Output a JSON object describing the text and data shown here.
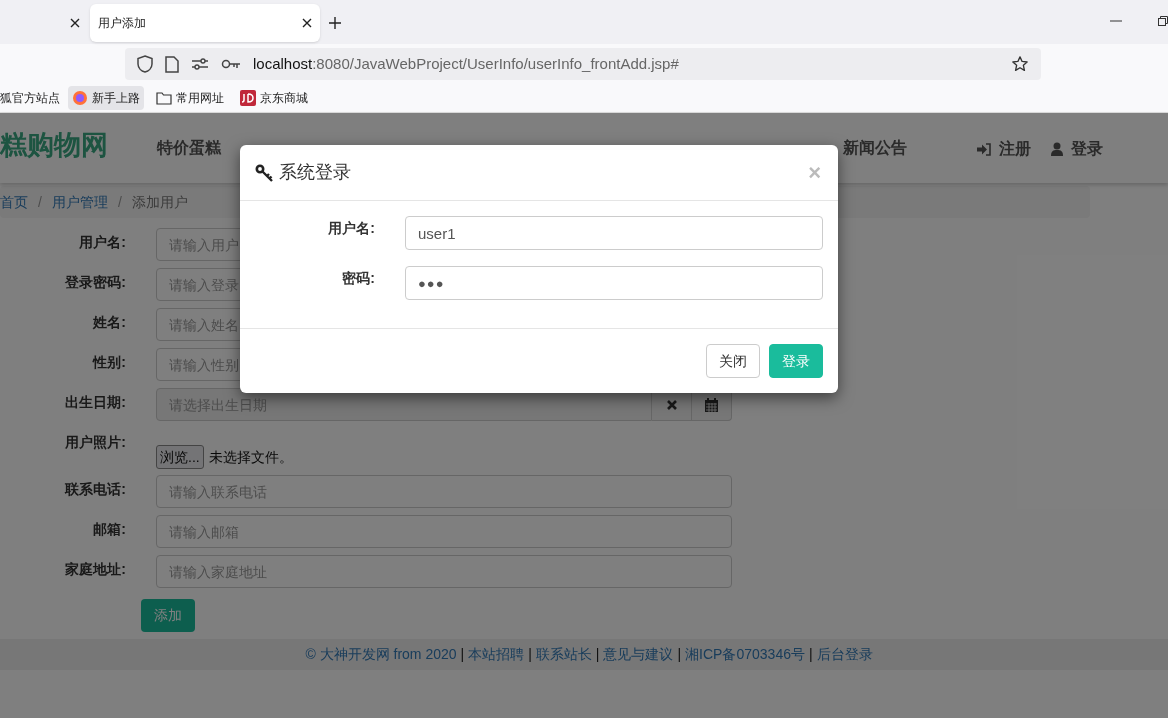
{
  "browser": {
    "tabs": [
      {
        "selected": false
      },
      {
        "label": "用户添加",
        "selected": true
      }
    ],
    "url": {
      "host": "localhost",
      "path": ":8080/JavaWebProject/UserInfo/userInfo_frontAdd.jsp#"
    },
    "bookmarks": [
      {
        "kind": "plain",
        "label": "狐官方站点"
      },
      {
        "kind": "firefox",
        "label": "新手上路"
      },
      {
        "kind": "folder",
        "label": "常用网址"
      },
      {
        "kind": "jd",
        "label": "京东商城"
      }
    ]
  },
  "navbar": {
    "brand": "糕购物网",
    "items": [
      {
        "label": "特价蛋糕"
      },
      {
        "label": "新闻公告"
      }
    ],
    "actions": [
      {
        "kind": "register",
        "label": "注册"
      },
      {
        "kind": "login",
        "label": "登录"
      }
    ]
  },
  "breadcrumb": {
    "separator": "/",
    "items": [
      {
        "label": "首页",
        "link": true
      },
      {
        "label": "用户管理",
        "link": true
      },
      {
        "label": "添加用户",
        "link": false
      }
    ]
  },
  "form": {
    "fields": [
      {
        "kind": "text",
        "label": "用户名:",
        "placeholder": "请输入用户"
      },
      {
        "kind": "text",
        "label": "登录密码:",
        "placeholder": "请输入登录"
      },
      {
        "kind": "text",
        "label": "姓名:",
        "placeholder": "请输入姓名"
      },
      {
        "kind": "text",
        "label": "性别:",
        "placeholder": "请输入性别"
      },
      {
        "kind": "date",
        "label": "出生日期:",
        "placeholder": "请选择出生日期"
      },
      {
        "kind": "file",
        "label": "用户照片:",
        "button": "浏览...",
        "status": "未选择文件。"
      },
      {
        "kind": "text",
        "label": "联系电话:",
        "placeholder": "请输入联系电话"
      },
      {
        "kind": "text",
        "label": "邮箱:",
        "placeholder": "请输入邮箱"
      },
      {
        "kind": "text",
        "label": "家庭地址:",
        "placeholder": "请输入家庭地址"
      }
    ],
    "submit": "添加"
  },
  "footer": {
    "separator": "|",
    "items": [
      "© 大神开发网 from 2020",
      "本站招聘",
      "联系站长",
      "意见与建议",
      "湘ICP备0703346号",
      "后台登录"
    ]
  },
  "modal": {
    "title": "系统登录",
    "close": "×",
    "fields": [
      {
        "label": "用户名:",
        "value": "user1",
        "kind": "text"
      },
      {
        "label": "密码:",
        "value": "●●●",
        "kind": "password"
      }
    ],
    "buttons": [
      {
        "label": "关闭",
        "primary": false
      },
      {
        "label": "登录",
        "primary": true
      }
    ]
  }
}
